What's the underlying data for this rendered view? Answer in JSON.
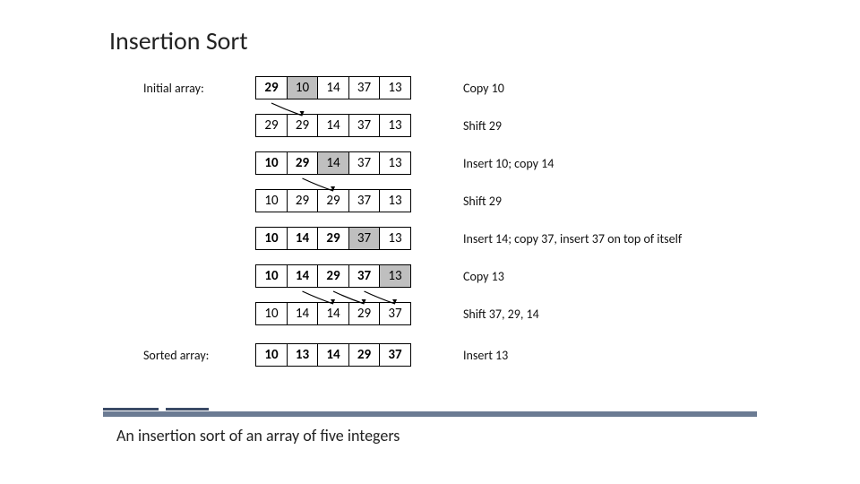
{
  "title": "Insertion Sort",
  "chart_data": {
    "type": "table",
    "steps": [
      {
        "label_left": "Initial array:",
        "cells": [
          {
            "v": 29,
            "bold": true
          },
          {
            "v": 10,
            "shaded": true
          },
          {
            "v": 14
          },
          {
            "v": 37
          },
          {
            "v": 13
          }
        ],
        "label_right": "Copy 10",
        "arrows": []
      },
      {
        "label_left": "",
        "cells": [
          {
            "v": 29
          },
          {
            "v": 29
          },
          {
            "v": 14
          },
          {
            "v": 37
          },
          {
            "v": 13
          }
        ],
        "label_right": "Shift 29",
        "arrows": [
          {
            "from": 0,
            "to": 1
          }
        ]
      },
      {
        "label_left": "",
        "cells": [
          {
            "v": 10,
            "bold": true
          },
          {
            "v": 29,
            "bold": true
          },
          {
            "v": 14,
            "shaded": true
          },
          {
            "v": 37
          },
          {
            "v": 13
          }
        ],
        "label_right": "Insert 10; copy 14",
        "arrows": []
      },
      {
        "label_left": "",
        "cells": [
          {
            "v": 10
          },
          {
            "v": 29
          },
          {
            "v": 29
          },
          {
            "v": 37
          },
          {
            "v": 13
          }
        ],
        "label_right": "Shift 29",
        "arrows": [
          {
            "from": 1,
            "to": 2
          }
        ]
      },
      {
        "label_left": "",
        "cells": [
          {
            "v": 10,
            "bold": true
          },
          {
            "v": 14,
            "bold": true
          },
          {
            "v": 29,
            "bold": true
          },
          {
            "v": 37,
            "shaded": true
          },
          {
            "v": 13
          }
        ],
        "label_right": "Insert 14; copy 37, insert 37 on top of itself",
        "arrows": []
      },
      {
        "label_left": "",
        "cells": [
          {
            "v": 10,
            "bold": true
          },
          {
            "v": 14,
            "bold": true
          },
          {
            "v": 29,
            "bold": true
          },
          {
            "v": 37,
            "bold": true
          },
          {
            "v": 13,
            "shaded": true
          }
        ],
        "label_right": "Copy 13",
        "arrows": []
      },
      {
        "label_left": "",
        "cells": [
          {
            "v": 10
          },
          {
            "v": 14
          },
          {
            "v": 14
          },
          {
            "v": 29
          },
          {
            "v": 37
          }
        ],
        "label_right": "Shift 37, 29, 14",
        "arrows": [
          {
            "from": 1,
            "to": 2
          },
          {
            "from": 2,
            "to": 3
          },
          {
            "from": 3,
            "to": 4
          }
        ]
      },
      {
        "label_left": "Sorted array:",
        "cells": [
          {
            "v": 10,
            "bold": true
          },
          {
            "v": 13,
            "bold": true
          },
          {
            "v": 14,
            "bold": true
          },
          {
            "v": 29,
            "bold": true
          },
          {
            "v": 37,
            "bold": true
          }
        ],
        "label_right": "Insert 13",
        "arrows": []
      }
    ]
  },
  "caption": "An insertion sort of an array of five integers"
}
